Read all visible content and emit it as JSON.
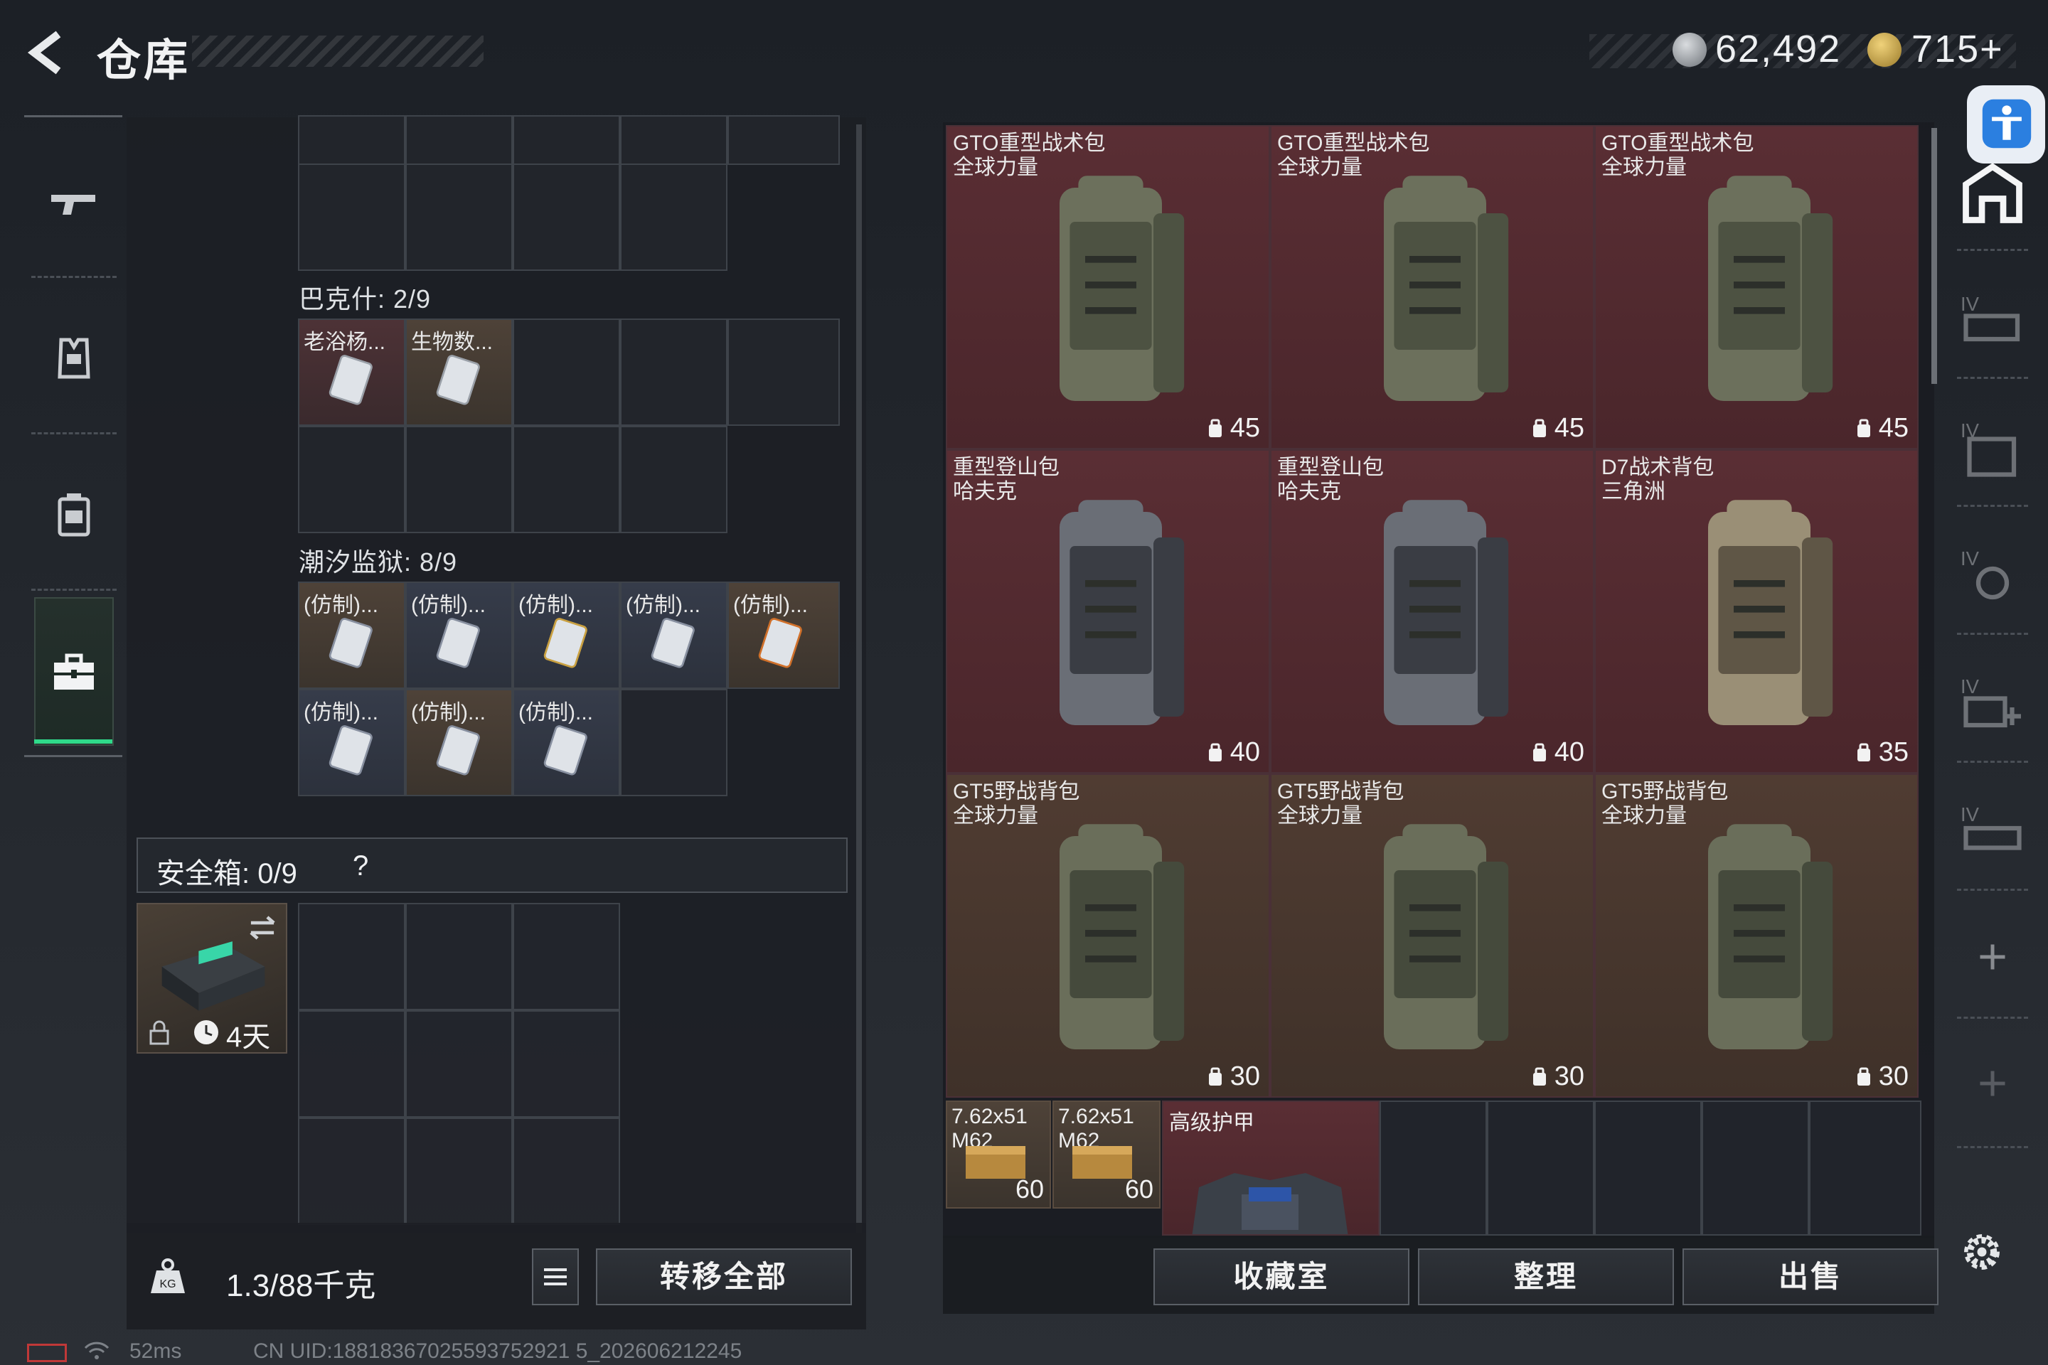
{
  "header": {
    "title": "仓库",
    "currency1": "62,492",
    "currency2": "715+"
  },
  "left_top_section": {},
  "section_baksh": {
    "label": "巴克什: 2/9",
    "items": [
      {
        "label": "老浴杨..."
      },
      {
        "label": "生物数..."
      }
    ]
  },
  "section_prison": {
    "label": "潮汐监狱: 8/9",
    "items": [
      {
        "label": "(仿制)..."
      },
      {
        "label": "(仿制)..."
      },
      {
        "label": "(仿制)..."
      },
      {
        "label": "(仿制)..."
      },
      {
        "label": "(仿制)..."
      },
      {
        "label": "(仿制)..."
      },
      {
        "label": "(仿制)..."
      },
      {
        "label": "(仿制)..."
      }
    ]
  },
  "safe_box": {
    "label": "安全箱: 0/9",
    "help": "?",
    "timer": "4天"
  },
  "bottom_left": {
    "weight": "1.3/88千克",
    "transfer_all": "转移全部"
  },
  "backpacks": [
    {
      "name": "GTO重型战术包",
      "sub": "全球力量",
      "capacity": "45",
      "tone": "red"
    },
    {
      "name": "GTO重型战术包",
      "sub": "全球力量",
      "capacity": "45",
      "tone": "red"
    },
    {
      "name": "GTO重型战术包",
      "sub": "全球力量",
      "capacity": "45",
      "tone": "red"
    },
    {
      "name": "重型登山包",
      "sub": "哈夫克",
      "capacity": "40",
      "tone": "red"
    },
    {
      "name": "重型登山包",
      "sub": "哈夫克",
      "capacity": "40",
      "tone": "red"
    },
    {
      "name": "D7战术背包",
      "sub": "三角洲",
      "capacity": "35",
      "tone": "red"
    },
    {
      "name": "GT5野战背包",
      "sub": "全球力量",
      "capacity": "30",
      "tone": "brown"
    },
    {
      "name": "GT5野战背包",
      "sub": "全球力量",
      "capacity": "30",
      "tone": "brown"
    },
    {
      "name": "GT5野战背包",
      "sub": "全球力量",
      "capacity": "30",
      "tone": "brown"
    }
  ],
  "ammo": [
    {
      "name": "7.62x51",
      "sub": "M62",
      "count": "60"
    },
    {
      "name": "7.62x51",
      "sub": "M62",
      "count": "60"
    }
  ],
  "armor": {
    "name": "高级护甲"
  },
  "right_buttons": {
    "collection": "收藏室",
    "organize": "整理",
    "sell": "出售"
  },
  "status_bar": {
    "ping": "52ms",
    "uid": "CN UID:18818367025593752921 5_202606212245"
  },
  "colors": {
    "accent_green": "#2fd98a",
    "rarity_red": "#5a2e34",
    "rarity_brown": "#503c32",
    "accessibility_blue": "#2b7fe0"
  },
  "icons": [
    "back-arrow-icon",
    "gun-icon",
    "vest-icon",
    "backpack-nav-icon",
    "briefcase-icon",
    "home-icon",
    "settings-icon",
    "lock-icon",
    "clock-icon",
    "swap-icon",
    "list-icon",
    "accessibility-icon"
  ]
}
